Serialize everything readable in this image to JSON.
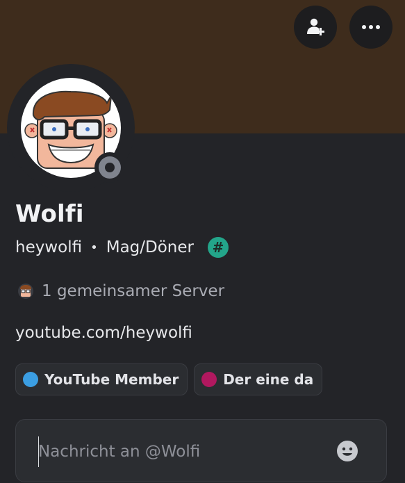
{
  "profile": {
    "display_name": "Wolfi",
    "username": "heywolfi",
    "separator": "•",
    "pronouns": "Mag/Döner",
    "server_tag_symbol": "#",
    "status": "offline"
  },
  "mutual_servers": {
    "label": "1 gemeinsamer Server"
  },
  "bio": {
    "link": "youtube.com/heywolfi"
  },
  "roles": [
    {
      "label": "YouTube Member",
      "color": "#3b9ee3"
    },
    {
      "label": "Der eine da",
      "color": "#b1185f"
    }
  ],
  "message": {
    "placeholder": "Nachricht an @Wolfi",
    "value": ""
  },
  "colors": {
    "banner": "#3e2c1c",
    "background": "#232428",
    "tag_badge": "#23a58a",
    "status_offline": "#80848e"
  },
  "icons": {
    "add_friend": "add-friend-icon",
    "more": "more-options-icon",
    "emoji": "emoji-icon"
  }
}
